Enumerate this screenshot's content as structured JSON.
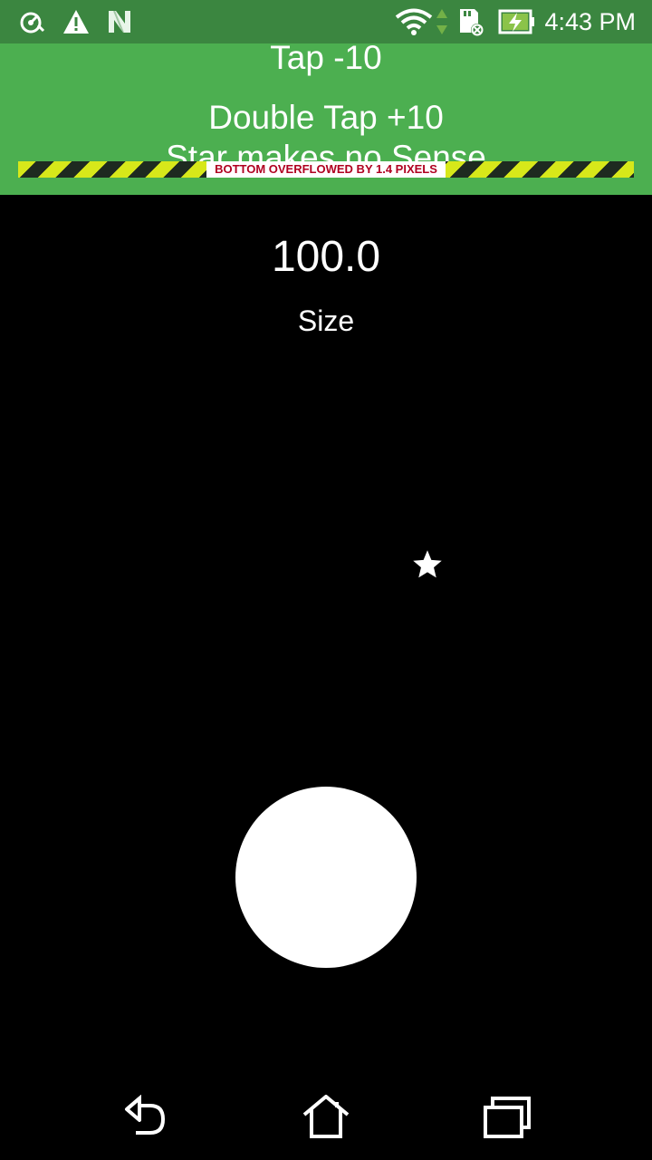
{
  "status_bar": {
    "time": "4:43 PM",
    "icons": [
      "data-saver-icon",
      "warning-icon",
      "n-icon",
      "wifi-icon",
      "data-arrows-icon",
      "sd-card-icon",
      "battery-charging-icon"
    ]
  },
  "header": {
    "line1": "Tap -10",
    "line2": "Double Tap +10",
    "line3": "Star makes no Sense",
    "overflow_warning": "BOTTOM OVERFLOWED BY 1.4 PIXELS",
    "color": "#4caf50"
  },
  "main": {
    "size_value": "100.0",
    "size_label": "Size"
  },
  "nav_bar": {
    "icons": [
      "back-icon",
      "home-icon",
      "recents-icon"
    ]
  }
}
